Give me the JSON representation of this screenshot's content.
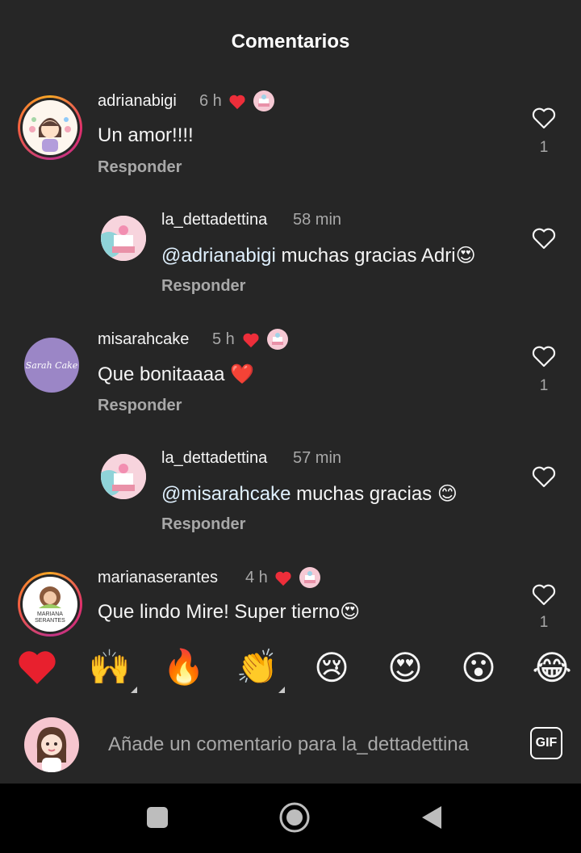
{
  "header": {
    "title": "Comentarios"
  },
  "comments": [
    {
      "username": "adrianabigi",
      "time": "6 h",
      "text": "Un amor!!!!",
      "reply_label": "Responder",
      "likes": "1"
    },
    {
      "username": "la_dettadettina",
      "time": "58 min",
      "mention": "@adrianabigi",
      "text": " muchas gracias Adri",
      "reply_label": "Responder"
    },
    {
      "username": "misarahcake",
      "time": "5 h",
      "avatar_text": "Sarah Cake",
      "text": "Que bonitaaaa",
      "reply_label": "Responder",
      "likes": "1"
    },
    {
      "username": "la_dettadettina",
      "time": "57 min",
      "mention": "@misarahcake",
      "text": " muchas gracias ",
      "reply_label": "Responder"
    },
    {
      "username": "marianaserantes",
      "time": "4 h",
      "avatar_text_1": "MARIANA",
      "avatar_text_2": "SERANTES",
      "text": "Que lindo Mire! Super tierno",
      "likes": "1"
    }
  ],
  "emoji_bar": [
    "❤️",
    "🙌",
    "🔥",
    "👏",
    "😢",
    "😍",
    "😮",
    "😂"
  ],
  "input": {
    "placeholder": "Añade un comentario para la_dettadettina",
    "gif_label": "GIF"
  },
  "colors": {
    "background": "#262626",
    "muted": "#a8a8a8",
    "heart_red": "#ed4956",
    "mention": "#e0f1ff"
  }
}
